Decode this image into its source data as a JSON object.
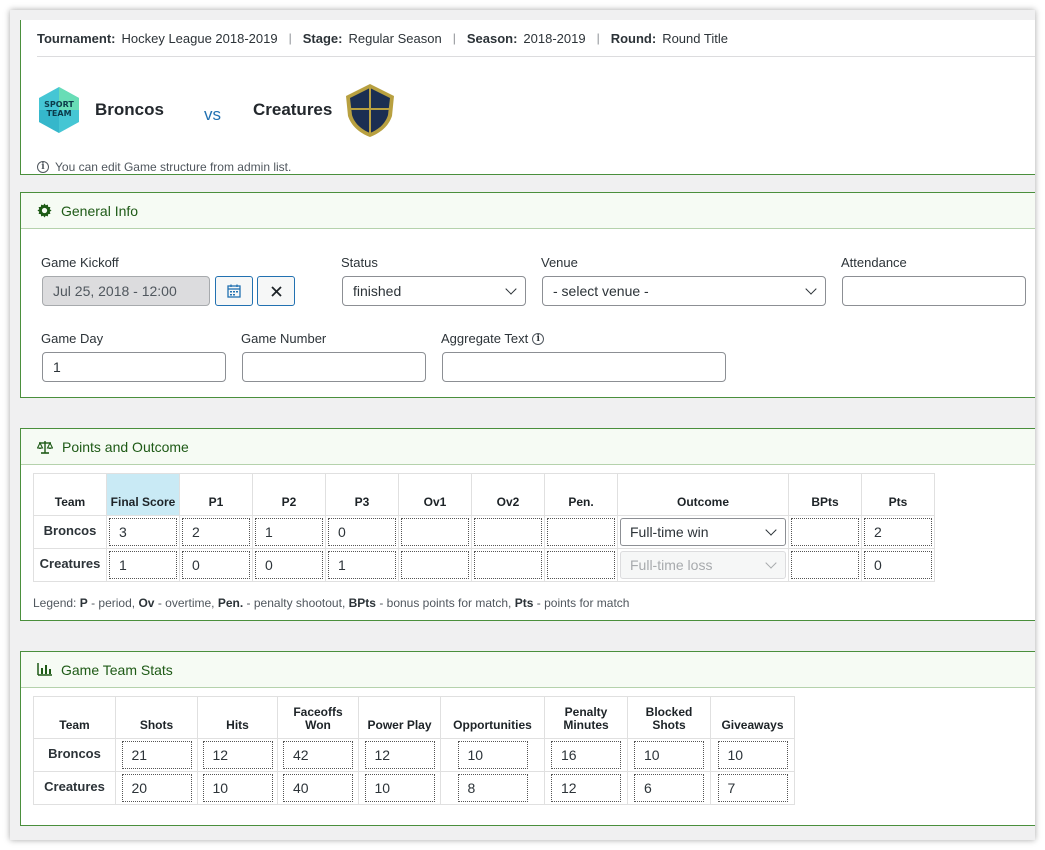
{
  "header": {
    "tournament_label": "Tournament:",
    "tournament": "Hockey League 2018-2019",
    "stage_label": "Stage:",
    "stage": "Regular Season",
    "season_label": "Season:",
    "season": "2018-2019",
    "round_label": "Round:",
    "round": "Round Title",
    "separator": "|",
    "home_team": "Broncos",
    "home_logo_text_1": "SPORT",
    "home_logo_text_2": "TEAM",
    "vs": "vs",
    "away_team": "Creatures",
    "info": "You can edit Game structure from admin list."
  },
  "general_info": {
    "title": "General Info",
    "kickoff_label": "Game Kickoff",
    "kickoff_value": "Jul 25, 2018 - 12:00",
    "status_label": "Status",
    "status_value": "finished",
    "venue_label": "Venue",
    "venue_value": "- select venue -",
    "attendance_label": "Attendance",
    "attendance_value": "",
    "game_day_label": "Game Day",
    "game_day_value": "1",
    "game_number_label": "Game Number",
    "game_number_value": "",
    "aggregate_label": "Aggregate Text",
    "aggregate_value": ""
  },
  "points_outcome": {
    "title": "Points and Outcome",
    "headers": [
      "Team",
      "Final Score",
      "P1",
      "P2",
      "P3",
      "Ov1",
      "Ov2",
      "Pen.",
      "Outcome",
      "BPts",
      "Pts"
    ],
    "rows": [
      {
        "team": "Broncos",
        "final": "3",
        "p1": "2",
        "p2": "1",
        "p3": "0",
        "ov1": "",
        "ov2": "",
        "pen": "",
        "outcome": "Full-time win",
        "bpts": "",
        "pts": "2"
      },
      {
        "team": "Creatures",
        "final": "1",
        "p1": "0",
        "p2": "0",
        "p3": "1",
        "ov1": "",
        "ov2": "",
        "pen": "",
        "outcome": "Full-time loss",
        "bpts": "",
        "pts": "0"
      }
    ],
    "legend_prefix": "Legend:",
    "legend_p": "P",
    "legend_p_text": "- period,",
    "legend_ov": "Ov",
    "legend_ov_text": "- overtime,",
    "legend_pen": "Pen.",
    "legend_pen_text": "- penalty shootout,",
    "legend_bpts": "BPts",
    "legend_bpts_text": "- bonus points for match,",
    "legend_pts": "Pts",
    "legend_pts_text": "- points for match"
  },
  "team_stats": {
    "title": "Game Team Stats",
    "headers": [
      "Team",
      "Shots",
      "Hits",
      "Faceoffs Won",
      "Power Play",
      "Opportunities",
      "Penalty Minutes",
      "Blocked Shots",
      "Giveaways"
    ],
    "rows": [
      {
        "team": "Broncos",
        "values": [
          "21",
          "12",
          "42",
          "12",
          "10",
          "16",
          "10",
          "10"
        ]
      },
      {
        "team": "Creatures",
        "values": [
          "20",
          "10",
          "40",
          "10",
          "8",
          "12",
          "6",
          "7"
        ]
      }
    ]
  },
  "colors": {
    "panel_border": "#4a8f3c",
    "section_title": "#1e5a16",
    "link_blue": "#2271b1",
    "final_score_header": "#c9eaf5"
  }
}
